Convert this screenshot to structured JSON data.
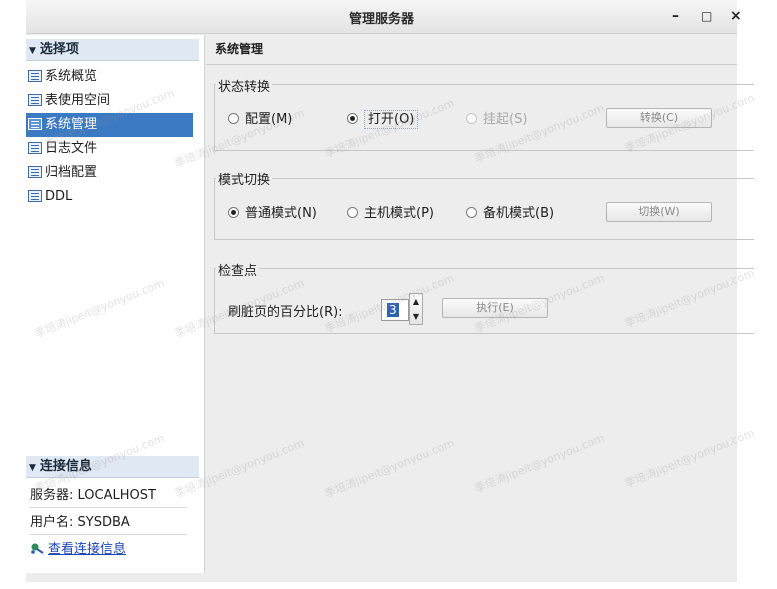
{
  "window": {
    "title": "管理服务器",
    "controls": [
      "–",
      "□",
      "×"
    ]
  },
  "sidebar": {
    "section_title": "选择项",
    "items": [
      {
        "label": "系统概览",
        "selected": false
      },
      {
        "label": "表使用空间",
        "selected": false
      },
      {
        "label": "系统管理",
        "selected": true
      },
      {
        "label": "日志文件",
        "selected": false
      },
      {
        "label": "归档配置",
        "selected": false
      },
      {
        "label": "DDL",
        "selected": false
      }
    ],
    "connection": {
      "section_title": "连接信息",
      "server": "服务器: LOCALHOST",
      "user": "用户名: SYSDBA",
      "view_link": "查看连接信息"
    }
  },
  "content": {
    "title": "系统管理",
    "state_group": {
      "title": "状态转换",
      "options": [
        "配置(M)",
        "打开(O)",
        "挂起(S)"
      ],
      "selected_index": 1,
      "button": "转换(C)"
    },
    "mode_group": {
      "title": "模式切换",
      "options": [
        "普通模式(N)",
        "主机模式(P)",
        "备机模式(B)"
      ],
      "selected_index": 0,
      "button": "切换(W)"
    },
    "checkpoint_group": {
      "title": "检查点",
      "label": "刷脏页的百分比(R):",
      "value": "3",
      "button": "执行(E)"
    }
  },
  "watermark": "季培涛jipeit@yonyou.com",
  "colors": {
    "selection": "#3b79c2",
    "section_header": "#dfe8f3",
    "link": "#1a46b4",
    "panel_bg": "#ededed"
  }
}
